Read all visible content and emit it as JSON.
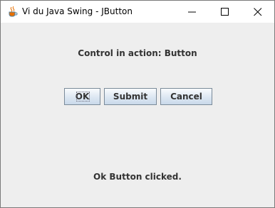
{
  "window": {
    "title": "Vi du Java Swing - JButton",
    "icon": "java-coffee-icon",
    "controls": [
      "minimize-icon",
      "maximize-icon",
      "close-icon"
    ]
  },
  "main": {
    "heading": "Control in action: Button",
    "buttons": [
      {
        "label": "OK",
        "focused": true
      },
      {
        "label": "Submit"
      },
      {
        "label": "Cancel"
      }
    ],
    "status": "Ok Button clicked."
  },
  "colors": {
    "content_bg": "#eeeeee",
    "text": "#333333",
    "button_border": "#7a8a99",
    "button_gradient_top": "#f9fbfd",
    "button_gradient_bottom": "#c9d9ea"
  }
}
